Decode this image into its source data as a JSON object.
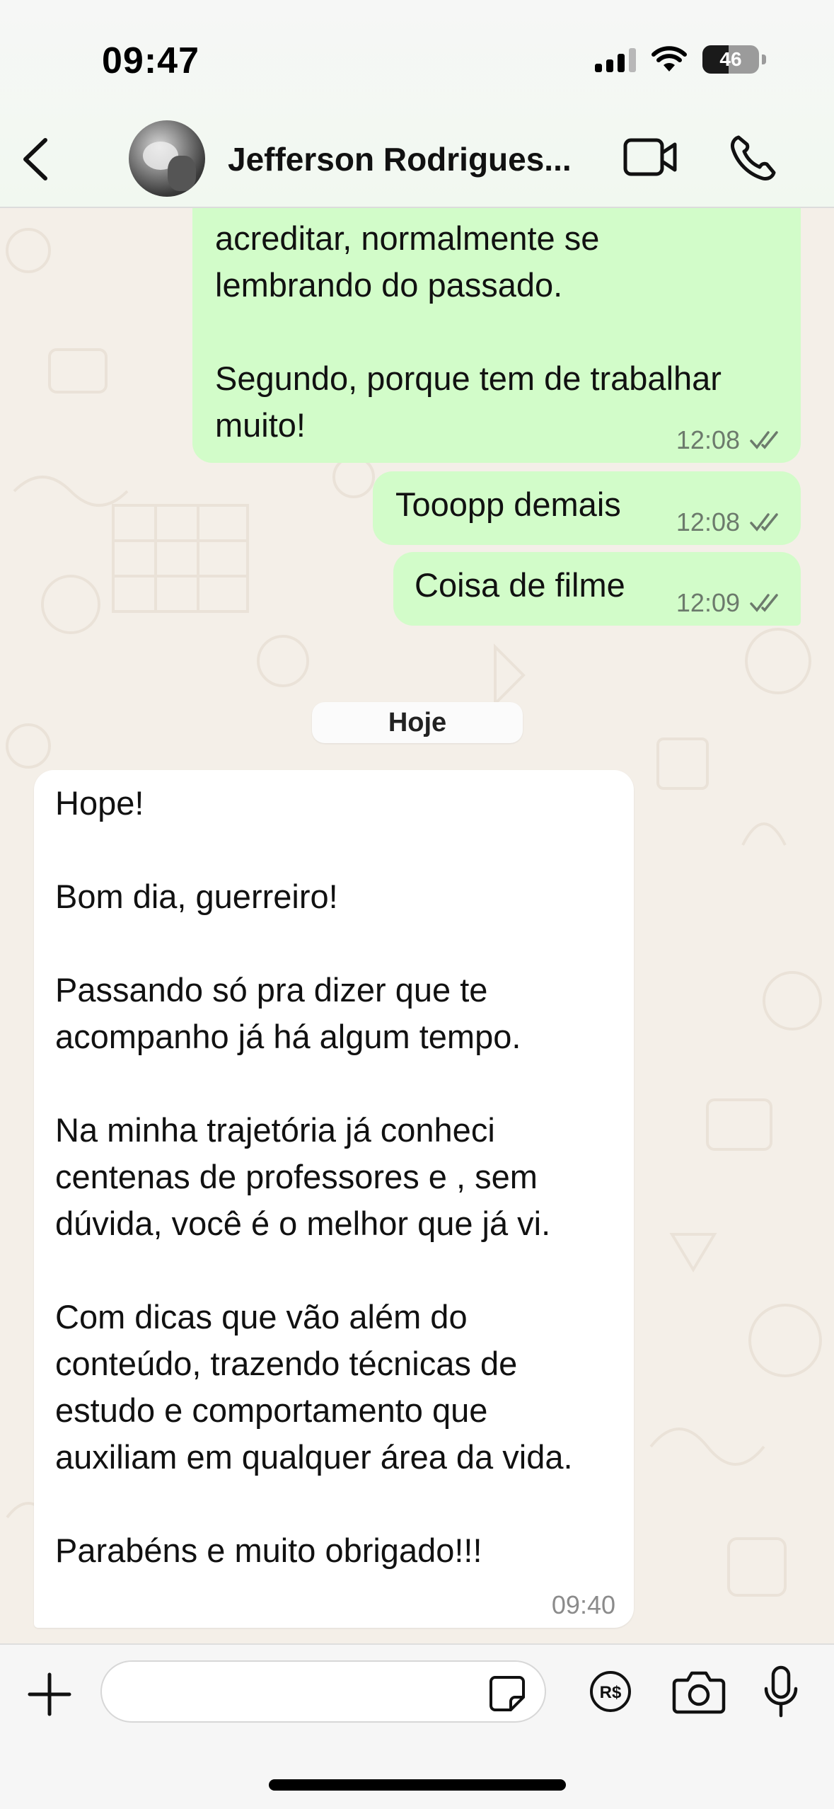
{
  "status_bar": {
    "time": "09:47",
    "battery": "46",
    "battery_level": 0.46
  },
  "header": {
    "contact_name": "Jefferson Rodrigues...",
    "back_icon": "chevron-left-icon",
    "video_icon": "video-camera-icon",
    "call_icon": "phone-icon"
  },
  "messages": [
    {
      "direction": "outgoing",
      "text": "acreditar, normalmente se\nlembrando do passado.\n\nSegundo, porque tem de trabalhar\nmuito!",
      "time": "12:08",
      "status": "read"
    },
    {
      "direction": "outgoing",
      "text": "Tooopp demais",
      "time": "12:08",
      "status": "read"
    },
    {
      "direction": "outgoing",
      "text": "Coisa de filme",
      "time": "12:09",
      "status": "read"
    },
    {
      "direction": "incoming",
      "text": "Hope!\n\nBom dia, guerreiro!\n\nPassando só pra dizer que te\nacompanho já há algum tempo.\n\nNa minha trajetória já conheci\ncentenas de professores e , sem\ndúvida, você é o melhor que já vi.\n\nCom dicas que vão além do\nconteúdo, trazendo técnicas de\nestudo e comportamento que\nauxiliam em qualquer área da vida.\n\nParabéns e muito obrigado!!!",
      "time": "09:40"
    }
  ],
  "day_separator": "Hoje",
  "composer": {
    "placeholder": "",
    "icons": [
      "plus-icon",
      "sticker-icon",
      "payment-icon",
      "camera-icon",
      "microphone-icon"
    ]
  },
  "colors": {
    "outgoing_bubble": "#d2fcc9",
    "incoming_bubble": "#ffffff",
    "chat_background": "#f4efe8",
    "read_ticks": "#53bdeb"
  }
}
